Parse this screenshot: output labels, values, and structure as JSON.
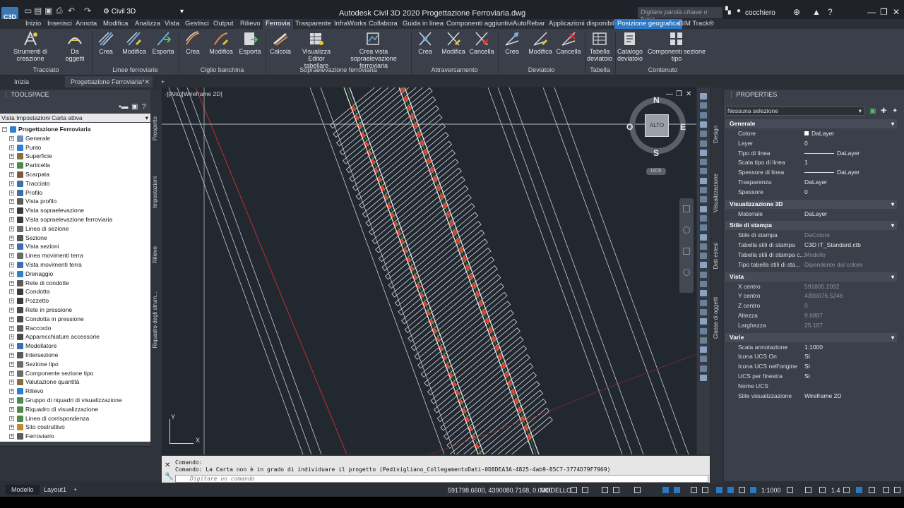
{
  "titlebar": {
    "app_icon": "C3D",
    "workspace": "Civil 3D",
    "title": "Autodesk Civil 3D 2020    Progettazione Ferroviaria.dwg",
    "search_placeholder": "Digitare parola chiave o frase",
    "user": "cocchiero"
  },
  "menu_tabs": [
    "Inizio",
    "Inserisci",
    "Annota",
    "Modifica",
    "Analizza",
    "Vista",
    "Gestisci",
    "Output",
    "Rilievo",
    "Ferrovia",
    "Trasparente",
    "InfraWorks",
    "Collabora",
    "Guida in linea",
    "Componenti aggiuntivi",
    "AutoRebar",
    "Applicazioni disponibili",
    "Posizione geografica",
    "BIM Track®"
  ],
  "active_menu_tab": "Ferrovia",
  "ribbon": {
    "buttons": {
      "strumenti": "Strumenti di creazione",
      "da_oggetti": "Da oggetti",
      "crea1": "Crea",
      "modifica1": "Modifica",
      "esporta1": "Esporta",
      "crea2": "Crea",
      "modifica2": "Modifica",
      "esporta2": "Esporta",
      "calcola": "Calcola",
      "visualizza_editor_1": "Visualizza Editor",
      "visualizza_editor_2": "tabellare",
      "crea_vista_1": "Crea vista",
      "crea_vista_2": "sopraelevazione ferroviaria",
      "crea3": "Crea",
      "modifica3": "Modifica",
      "cancella1": "Cancella",
      "crea4": "Crea",
      "modifica4": "Modifica",
      "cancella2": "Cancella",
      "tabella_dev_1": "Tabella",
      "tabella_dev_2": "deviatoio",
      "catalogo_1": "Catalogo",
      "catalogo_2": "deviatoio",
      "componenti_sezione": "Componenti sezione tipo"
    },
    "groups": {
      "tracciato": "Tracciato",
      "linee": "Linee ferroviarie",
      "ciglio": "Ciglio banchina",
      "sopraelevazione": "Sopraelevazione ferroviaria",
      "attraversamento": "Attraversamento",
      "deviatoio": "Deviatoio",
      "tabella": "Tabella",
      "contenuto": "Contenuto"
    }
  },
  "doc_tabs": {
    "inizia": "Inizia",
    "drawing": "Progettazione Ferroviaria*"
  },
  "toolspace": {
    "title": "TOOLSPACE",
    "combo": "Vista Impostazioni Carta attiva",
    "root": "Progettazione Ferroviaria",
    "items": [
      "Generale",
      "Punto",
      "Superficie",
      "Particella",
      "Scarpata",
      "Tracciato",
      "Profilo",
      "Vista profilo",
      "Vista sopraelevazione",
      "Vista sopraelevazione ferroviaria",
      "Linea di sezione",
      "Sezione",
      "Vista sezioni",
      "Linea movimenti terra",
      "Vista movimenti terra",
      "Drenaggio",
      "Rete di condotte",
      "Condotta",
      "Pozzetto",
      "Rete in pressione",
      "Condotta in pressione",
      "Raccordo",
      "Apparecchiature accessorie",
      "Modellatore",
      "Intersezione",
      "Sezione tipo",
      "Componente sezione tipo",
      "Valutazione quantità",
      "Rilievo",
      "Gruppo di riquadri di visualizzazione",
      "Riquadro di visualizzazione",
      "Linea di corrispondenza",
      "Sito costruttivo",
      "Ferroviario"
    ],
    "vtabs": [
      "Prospetto",
      "Impostazioni",
      "Rilievo",
      "Riquadro degli strum..."
    ]
  },
  "viewport": {
    "label": "-][Alto][Wireframe 2D]",
    "viewcube_top": "ALTO",
    "compass": {
      "n": "N",
      "s": "S",
      "e": "E",
      "o": "O"
    },
    "ucs_label": "UCS",
    "axis_y": "Y",
    "axis_x": "X"
  },
  "command": {
    "line1": "Comando:",
    "line2": "Comando: La Carta non è in grado di individuare il progetto (Pedivigliano_CollegamentoDati-0D8DEA3A-4825-4ab9-85C7-3774D79F7969)",
    "placeholder": "Digitare un comando"
  },
  "properties": {
    "title": "PROPERTIES",
    "selection": "Nessuna selezione",
    "vtabs": [
      "Design",
      "Visualizzazione",
      "Dati estesi",
      "Classe di oggetti"
    ],
    "sections": [
      {
        "title": "Generale",
        "rows": [
          {
            "name": "Colore",
            "value": "DaLayer"
          },
          {
            "name": "Layer",
            "value": "0"
          },
          {
            "name": "Tipo di linea",
            "value": "DaLayer"
          },
          {
            "name": "Scala tipo di linea",
            "value": "1"
          },
          {
            "name": "Spessore di linea",
            "value": "DaLayer"
          },
          {
            "name": "Trasparenza",
            "value": "DaLayer"
          },
          {
            "name": "Spessore",
            "value": "0"
          }
        ]
      },
      {
        "title": "Visualizzazione 3D",
        "rows": [
          {
            "name": "Materiale",
            "value": "DaLayer"
          }
        ]
      },
      {
        "title": "Stile di stampa",
        "rows": [
          {
            "name": "Stile di stampa",
            "value": "DaColore"
          },
          {
            "name": "Tabella stili di stampa",
            "value": "C3D IT_Standard.ctb"
          },
          {
            "name": "Tabella stili di stampa c...",
            "value": "Modello"
          },
          {
            "name": "Tipo tabella stili di sta...",
            "value": "Dipendente dal colore"
          }
        ]
      },
      {
        "title": "Vista",
        "rows": [
          {
            "name": "X centro",
            "value": "591805.2092"
          },
          {
            "name": "Y centro",
            "value": "4390076.5246"
          },
          {
            "name": "Z centro",
            "value": "0"
          },
          {
            "name": "Altezza",
            "value": "9.6887"
          },
          {
            "name": "Larghezza",
            "value": "25.167"
          }
        ]
      },
      {
        "title": "Varie",
        "rows": [
          {
            "name": "Scala annotazione",
            "value": "1:1000"
          },
          {
            "name": "Icona UCS On",
            "value": "Sì"
          },
          {
            "name": "Icona UCS nell'origine",
            "value": "Sì"
          },
          {
            "name": "UCS per finestra",
            "value": "Sì"
          },
          {
            "name": "Nome UCS",
            "value": ""
          },
          {
            "name": "Stile visualizzazione",
            "value": "Wireframe 2D"
          }
        ]
      }
    ]
  },
  "statusbar": {
    "tab_model": "Modello",
    "tab_layout": "Layout1",
    "coords": "591798.6600, 4390080.7168, 0.0000",
    "model": "MODELLO",
    "scale": "1:1000",
    "lineweight": "1.4"
  },
  "colors": {
    "accent": "#2b78c6",
    "drawing_bg": "#212830",
    "rail_red": "#e0312b",
    "rail_green": "#3fbf3f"
  }
}
